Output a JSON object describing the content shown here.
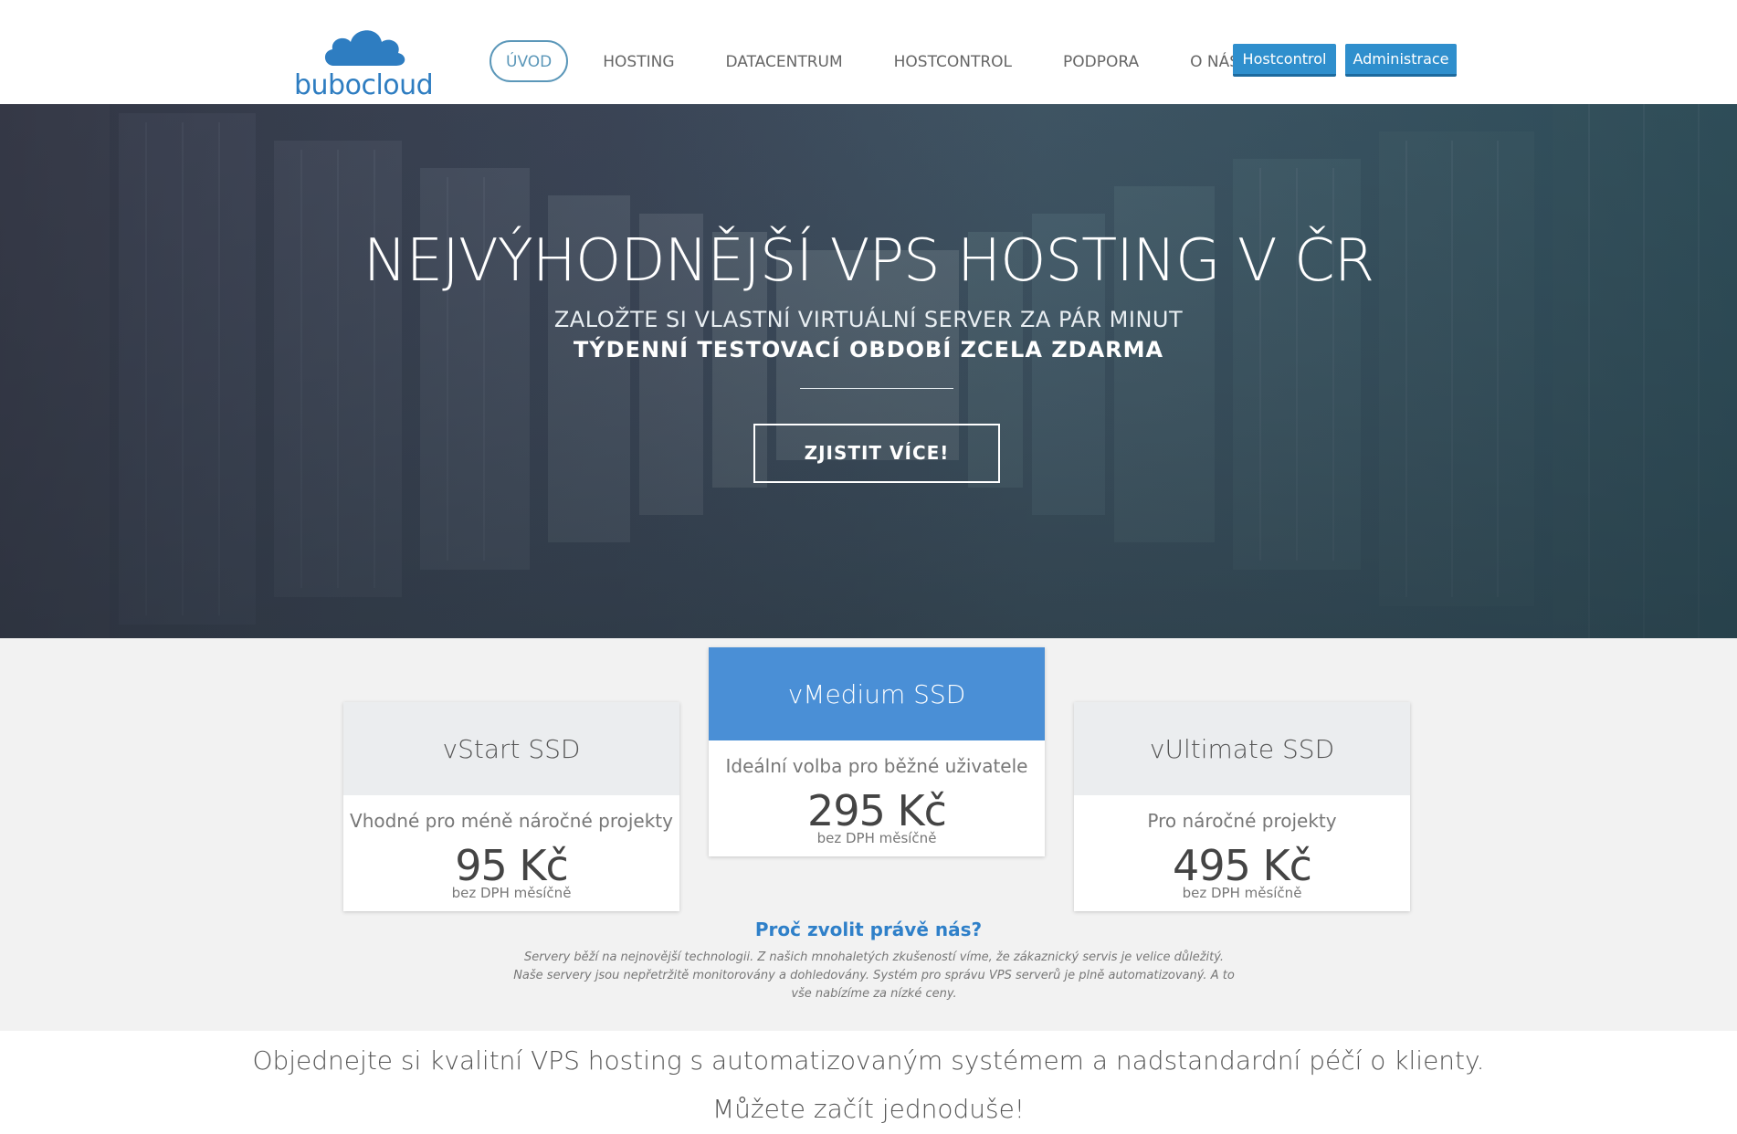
{
  "header": {
    "logo_text": "bubocloud",
    "nav": [
      {
        "label": "Úvod"
      },
      {
        "label": "Hosting"
      },
      {
        "label": "Datacentrum"
      },
      {
        "label": "Hostcontrol"
      },
      {
        "label": "Podpora"
      },
      {
        "label": "O nás"
      }
    ],
    "btn_hostcontrol": "Hostcontrol",
    "btn_administrace": "Administrace"
  },
  "hero": {
    "title": "NEJVÝHODNĚJŠÍ VPS HOSTING V ČR",
    "subtitle1": "ZALOŽTE SI VLASTNÍ VIRTUÁLNÍ SERVER ZA PÁR MINUT",
    "subtitle2": "TÝDENNÍ TESTOVACÍ OBDOBÍ ZCELA ZDARMA",
    "cta": "ZJISTIT VÍCE!"
  },
  "plans": [
    {
      "name": "vStart SSD",
      "desc": "Vhodné pro méně náročné projekty",
      "price": "95 Kč",
      "note": "bez DPH měsíčně"
    },
    {
      "name": "vMedium SSD",
      "desc": "Ideální volba pro běžné uživatele",
      "price": "295 Kč",
      "note": "bez DPH měsíčně"
    },
    {
      "name": "vUltimate SSD",
      "desc": "Pro náročné projekty",
      "price": "495 Kč",
      "note": "bez DPH měsíčně"
    }
  ],
  "why": {
    "title": "Proč zvolit právě nás?",
    "text": "Servery běží na nejnovější technologii. Z našich mnohaletých zkušeností víme, že zákaznický servis je velice důležitý. Naše servery jsou nepřetržitě monitorovány a dohledovány. Systém pro správu VPS serverů je plně automatizovaný. A to vše nabízíme za nízké ceny."
  },
  "bottom": {
    "line1": "Objednejte si kvalitní VPS hosting s automatizovaným systémem a nadstandardní péčí o klienty.",
    "line2": "Můžete začít jednoduše!"
  },
  "colors": {
    "accent": "#2f8fcd",
    "featured": "#4a8fd6",
    "nav_active": "#5b97b9"
  }
}
